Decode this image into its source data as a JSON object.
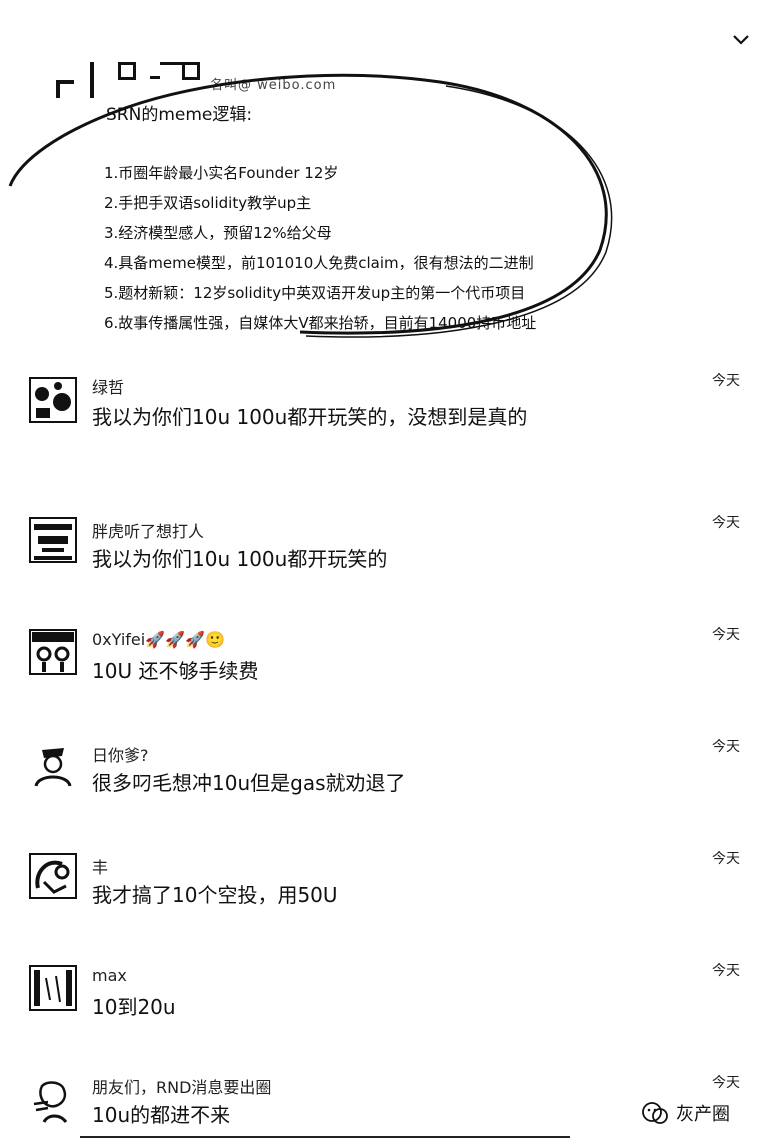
{
  "post": {
    "handle": "名叫@ weibo.com",
    "heading": "SRN的meme逻辑:",
    "items": [
      "1.币圈年龄最小实名Founder 12岁",
      "2.手把手双语solidity教学up主",
      "3.经济模型感人，预留12%给父母",
      "4.具备meme模型，前101010人免费claim，很有想法的二进制",
      "5.题材新颖：12岁solidity中英双语开发up主的第一个代币项目",
      "6.故事传播属性强，自媒体大V都来抬轿，目前有14000持币地址"
    ]
  },
  "comments": [
    {
      "name": "绿哲",
      "text": "我以为你们10u  100u都开玩笑的，没想到是真的",
      "time": "今天"
    },
    {
      "name": "胖虎听了想打人",
      "text": "我以为你们10u  100u都开玩笑的",
      "time": "今天"
    },
    {
      "name": "0xYifei🚀🚀🚀🙂",
      "text": "10U 还不够手续费",
      "time": "今天"
    },
    {
      "name": "日你爹?",
      "text": "很多叼毛想冲10u但是gas就劝退了",
      "time": "今天"
    },
    {
      "name": "丰",
      "text": "我才搞了10个空投，用50U",
      "time": "今天"
    },
    {
      "name": "max",
      "text": "10到20u",
      "time": "今天"
    },
    {
      "name": "朋友们，RND消息要出圈",
      "text": "10u的都进不来",
      "time": "今天"
    }
  ],
  "watermark": "灰产圈",
  "icons": {
    "collapse": "chevron-down-icon",
    "watermark": "wechat-dots-icon"
  }
}
